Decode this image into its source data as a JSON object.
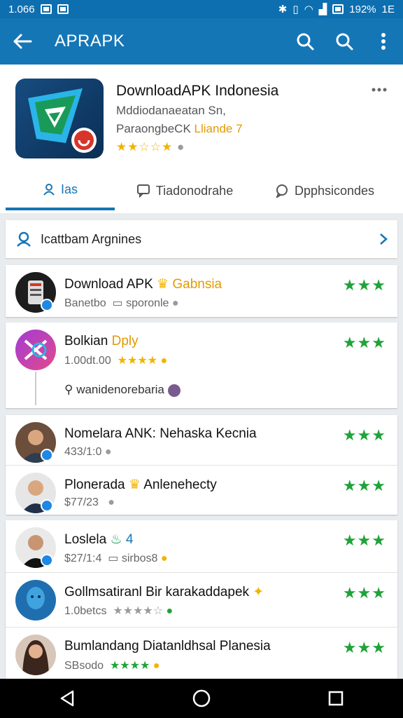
{
  "status": {
    "time": "1.066",
    "battery": "192%",
    "net": "1E"
  },
  "appbar": {
    "title": "APRAPK"
  },
  "app": {
    "title": "DownloadAPK Indonesia",
    "subtitle1": "Mddiodanaeatan Sn,",
    "subtitle2_prefix": "ParaongbeCK",
    "subtitle2_highlight": "Lliande 7",
    "rating": "★★☆☆★"
  },
  "tabs": [
    {
      "label": "Ias"
    },
    {
      "label": "Tiadonodrahe"
    },
    {
      "label": "Dpphsicondes"
    }
  ],
  "section": {
    "label": "Icattbam Argnines"
  },
  "items": [
    {
      "title": "Download APK",
      "title_highlight": "Gabnsia",
      "meta": "Banetbo",
      "meta2": "sporonle",
      "stars": "★★★"
    },
    {
      "title": "Bolkian",
      "title_highlight": "Dply",
      "meta": "1.00dt.00",
      "meta_stars": "★★★★",
      "meta2": "wanidenorebaria",
      "stars": "★★★"
    },
    {
      "title": "Nomelara ANK: Nehaska Kecnia",
      "meta": "433/1:0",
      "stars": "★★★"
    },
    {
      "title": "Plonerada",
      "title_highlight": "Anlenehecty",
      "meta": "$77/23",
      "stars": "★★★"
    },
    {
      "title": "Loslela",
      "title_highlight": "4",
      "meta": "$27/1:4",
      "meta2": "sirbos8",
      "stars": "★★★"
    },
    {
      "title": "Gollmsatiranl Bir karakaddapek",
      "meta": "1.0betcs",
      "meta_stars": "★★★★☆",
      "stars": "★★★"
    },
    {
      "title": "Bumlandang Diatanldhsal Planesia",
      "meta": "SBsodo",
      "meta_stars": "★★★★",
      "stars": "★★★"
    }
  ]
}
